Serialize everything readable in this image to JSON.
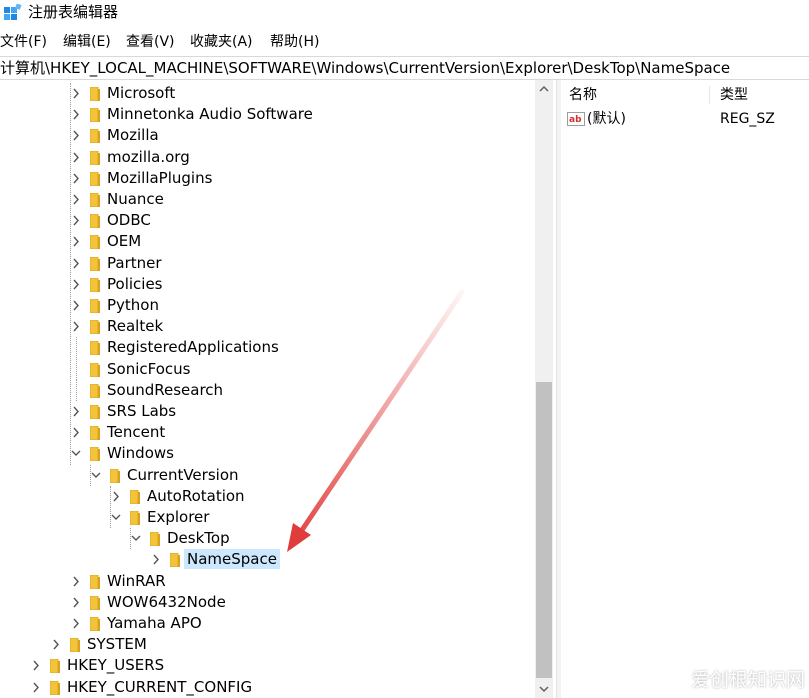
{
  "window": {
    "title": "注册表编辑器"
  },
  "menu": [
    "文件(F)",
    "编辑(E)",
    "查看(V)",
    "收藏夹(A)",
    "帮助(H)"
  ],
  "address": "计算机\\HKEY_LOCAL_MACHINE\\SOFTWARE\\Windows\\CurrentVersion\\Explorer\\DeskTop\\NameSpace",
  "tree": [
    {
      "label": "Microsoft",
      "expander": "collapsed"
    },
    {
      "label": "Minnetonka Audio Software",
      "expander": "collapsed"
    },
    {
      "label": "Mozilla",
      "expander": "collapsed"
    },
    {
      "label": "mozilla.org",
      "expander": "collapsed"
    },
    {
      "label": "MozillaPlugins",
      "expander": "collapsed"
    },
    {
      "label": "Nuance",
      "expander": "collapsed"
    },
    {
      "label": "ODBC",
      "expander": "collapsed"
    },
    {
      "label": "OEM",
      "expander": "collapsed"
    },
    {
      "label": "Partner",
      "expander": "collapsed"
    },
    {
      "label": "Policies",
      "expander": "collapsed"
    },
    {
      "label": "Python",
      "expander": "collapsed"
    },
    {
      "label": "Realtek",
      "expander": "collapsed"
    },
    {
      "label": "RegisteredApplications",
      "expander": "none"
    },
    {
      "label": "SonicFocus",
      "expander": "none"
    },
    {
      "label": "SoundResearch",
      "expander": "none"
    },
    {
      "label": "SRS Labs",
      "expander": "collapsed"
    },
    {
      "label": "Tencent",
      "expander": "collapsed"
    },
    {
      "label": "Windows",
      "expander": "expanded"
    },
    {
      "label": "CurrentVersion",
      "expander": "expanded"
    },
    {
      "label": "AutoRotation",
      "expander": "collapsed"
    },
    {
      "label": "Explorer",
      "expander": "expanded"
    },
    {
      "label": "DeskTop",
      "expander": "expanded"
    },
    {
      "label": "NameSpace",
      "expander": "collapsed",
      "selected": true
    },
    {
      "label": "WinRAR",
      "expander": "collapsed"
    },
    {
      "label": "WOW6432Node",
      "expander": "collapsed"
    },
    {
      "label": "Yamaha APO",
      "expander": "collapsed"
    },
    {
      "label": "SYSTEM",
      "expander": "collapsed"
    },
    {
      "label": "HKEY_USERS",
      "expander": "collapsed"
    },
    {
      "label": "HKEY_CURRENT_CONFIG",
      "expander": "collapsed"
    }
  ],
  "list": {
    "columns": {
      "name": "名称",
      "type": "类型"
    },
    "rows": [
      {
        "name": "(默认)",
        "type": "REG_SZ",
        "icon": "string-value-icon"
      }
    ]
  },
  "watermark": "爱创根知识网",
  "colors": {
    "selection": "#cce8ff",
    "arrow": "#e03c3c",
    "folder": "#f3c33b",
    "folder_edge": "#d9a21b"
  }
}
